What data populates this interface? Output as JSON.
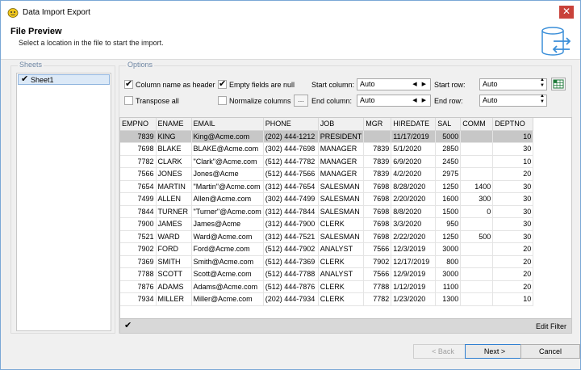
{
  "window": {
    "title": "Data Import Export",
    "close_glyph": "✕"
  },
  "header": {
    "title": "File Preview",
    "subtitle": "Select a location in the file to start the import."
  },
  "sheets": {
    "label": "Sheets",
    "items": [
      {
        "label": "Sheet1",
        "checked": true
      }
    ]
  },
  "options": {
    "label": "Options",
    "column_name_as_header": {
      "label": "Column name as header",
      "checked": true
    },
    "empty_fields_are_null": {
      "label": "Empty fields are null",
      "checked": true
    },
    "transpose_all": {
      "label": "Transpose all",
      "checked": false
    },
    "normalize_columns": {
      "label": "Normalize columns",
      "checked": false
    },
    "dots_button": "...",
    "start_column": {
      "label": "Start column:",
      "value": "Auto"
    },
    "end_column": {
      "label": "End column:",
      "value": "Auto"
    },
    "start_row": {
      "label": "Start row:",
      "value": "Auto"
    },
    "end_row": {
      "label": "End row:",
      "value": "Auto"
    }
  },
  "grid": {
    "columns": [
      "EMPNO",
      "ENAME",
      "EMAIL",
      "PHONE",
      "JOB",
      "MGR",
      "HIREDATE",
      "SAL",
      "COMM",
      "DEPTNO"
    ],
    "rows": [
      [
        "7839",
        "KING",
        "King@Acme.com",
        "(202) 444-1212",
        "PRESIDENT",
        "",
        "11/17/2019",
        "5000",
        "",
        "10"
      ],
      [
        "7698",
        "BLAKE",
        "BLAKE@Acme.com",
        "(302) 444-7698",
        "MANAGER",
        "7839",
        "5/1/2020",
        "2850",
        "",
        "30"
      ],
      [
        "7782",
        "CLARK",
        "\"Clark\"@Acme.com",
        "(512) 444-7782",
        "MANAGER",
        "7839",
        "6/9/2020",
        "2450",
        "",
        "10"
      ],
      [
        "7566",
        "JONES",
        "Jones@Acme",
        "(512) 444-7566",
        "MANAGER",
        "7839",
        "4/2/2020",
        "2975",
        "",
        "20"
      ],
      [
        "7654",
        "MARTIN",
        "\"Martin\"@Acme.com",
        "(312) 444-7654",
        "SALESMAN",
        "7698",
        "8/28/2020",
        "1250",
        "1400",
        "30"
      ],
      [
        "7499",
        "ALLEN",
        "Allen@Acme.com",
        "(302) 444-7499",
        "SALESMAN",
        "7698",
        "2/20/2020",
        "1600",
        "300",
        "30"
      ],
      [
        "7844",
        "TURNER",
        "\"Turner\"@Acme.com",
        "(312) 444-7844",
        "SALESMAN",
        "7698",
        "8/8/2020",
        "1500",
        "0",
        "30"
      ],
      [
        "7900",
        "JAMES",
        "James@Acme",
        "(312) 444-7900",
        "CLERK",
        "7698",
        "3/3/2020",
        "950",
        "",
        "30"
      ],
      [
        "7521",
        "WARD",
        "Ward@Acme.com",
        "(312) 444-7521",
        "SALESMAN",
        "7698",
        "2/22/2020",
        "1250",
        "500",
        "30"
      ],
      [
        "7902",
        "FORD",
        "Ford@Acme.com",
        "(512) 444-7902",
        "ANALYST",
        "7566",
        "12/3/2019",
        "3000",
        "",
        "20"
      ],
      [
        "7369",
        "SMITH",
        "Smith@Acme.com",
        "(512) 444-7369",
        "CLERK",
        "7902",
        "12/17/2019",
        "800",
        "",
        "20"
      ],
      [
        "7788",
        "SCOTT",
        "Scott@Acme.com",
        "(512) 444-7788",
        "ANALYST",
        "7566",
        "12/9/2019",
        "3000",
        "",
        "20"
      ],
      [
        "7876",
        "ADAMS",
        "Adams@Acme.com",
        "(512) 444-7876",
        "CLERK",
        "7788",
        "1/12/2019",
        "1100",
        "",
        "20"
      ],
      [
        "7934",
        "MILLER",
        "Miller@Acme.com",
        "(202) 444-7934",
        "CLERK",
        "7782",
        "1/23/2020",
        "1300",
        "",
        "10"
      ]
    ],
    "numeric_columns": [
      0,
      5,
      7,
      8,
      9
    ],
    "selected_row": 0,
    "footer_checked": true,
    "edit_filter_label": "Edit Filter"
  },
  "footer": {
    "back_label": "< Back",
    "next_label": "Next >",
    "cancel_label": "Cancel"
  },
  "colors": {
    "accent": "#2f7fd0",
    "close": "#c9423a",
    "group_label": "#6f87a4",
    "selected_row": "#c7c7c7"
  }
}
